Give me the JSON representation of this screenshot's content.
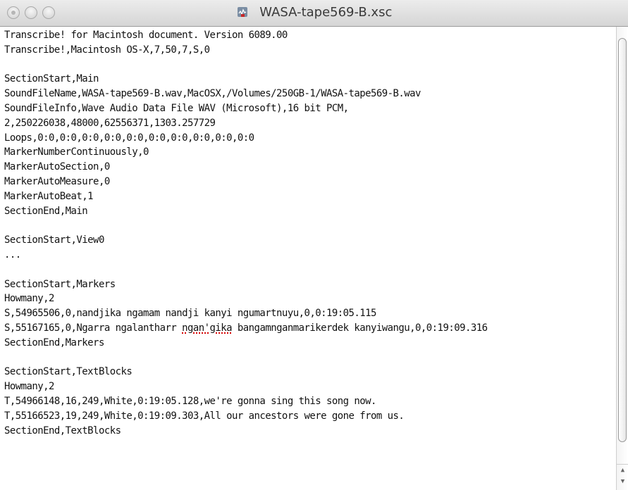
{
  "window": {
    "title": "WASA-tape569-B.xsc"
  },
  "content": {
    "lines": [
      "Transcribe! for Macintosh document. Version 6089.00",
      "Transcribe!,Macintosh OS-X,7,50,7,S,0",
      "",
      "SectionStart,Main",
      "SoundFileName,WASA-tape569-B.wav,MacOSX,/Volumes/250GB-1/WASA-tape569-B.wav",
      "SoundFileInfo,Wave Audio Data File WAV (Microsoft),16 bit PCM,",
      "2,250226038,48000,62556371,1303.257729",
      "Loops,0:0,0:0,0:0,0:0,0:0,0:0,0:0,0:0,0:0,0:0",
      "MarkerNumberContinuously,0",
      "MarkerAutoSection,0",
      "MarkerAutoMeasure,0",
      "MarkerAutoBeat,1",
      "SectionEnd,Main",
      "",
      "SectionStart,View0",
      "...",
      "",
      "SectionStart,Markers",
      "Howmany,2",
      "S,54965506,0,nandjika ngamam nandji kanyi ngumartnuyu,0,0:19:05.115",
      "",
      "SectionEnd,Markers",
      "",
      "SectionStart,TextBlocks",
      "Howmany,2",
      "T,54966148,16,249,White,0:19:05.128,we're gonna sing this song now.",
      "T,55166523,19,249,White,0:19:09.303,All our ancestors were gone from us.",
      "SectionEnd,TextBlocks"
    ],
    "marker_line_2": {
      "before": "S,55167165,0,Ngarra ngalantharr ",
      "misspelled": "ngan'gika",
      "after": " bangamnganmarikerdek kanyiwangu,0,0:19:09.316"
    }
  },
  "scrollbar": {
    "up_arrow": "▲",
    "down_arrow": "▼"
  }
}
